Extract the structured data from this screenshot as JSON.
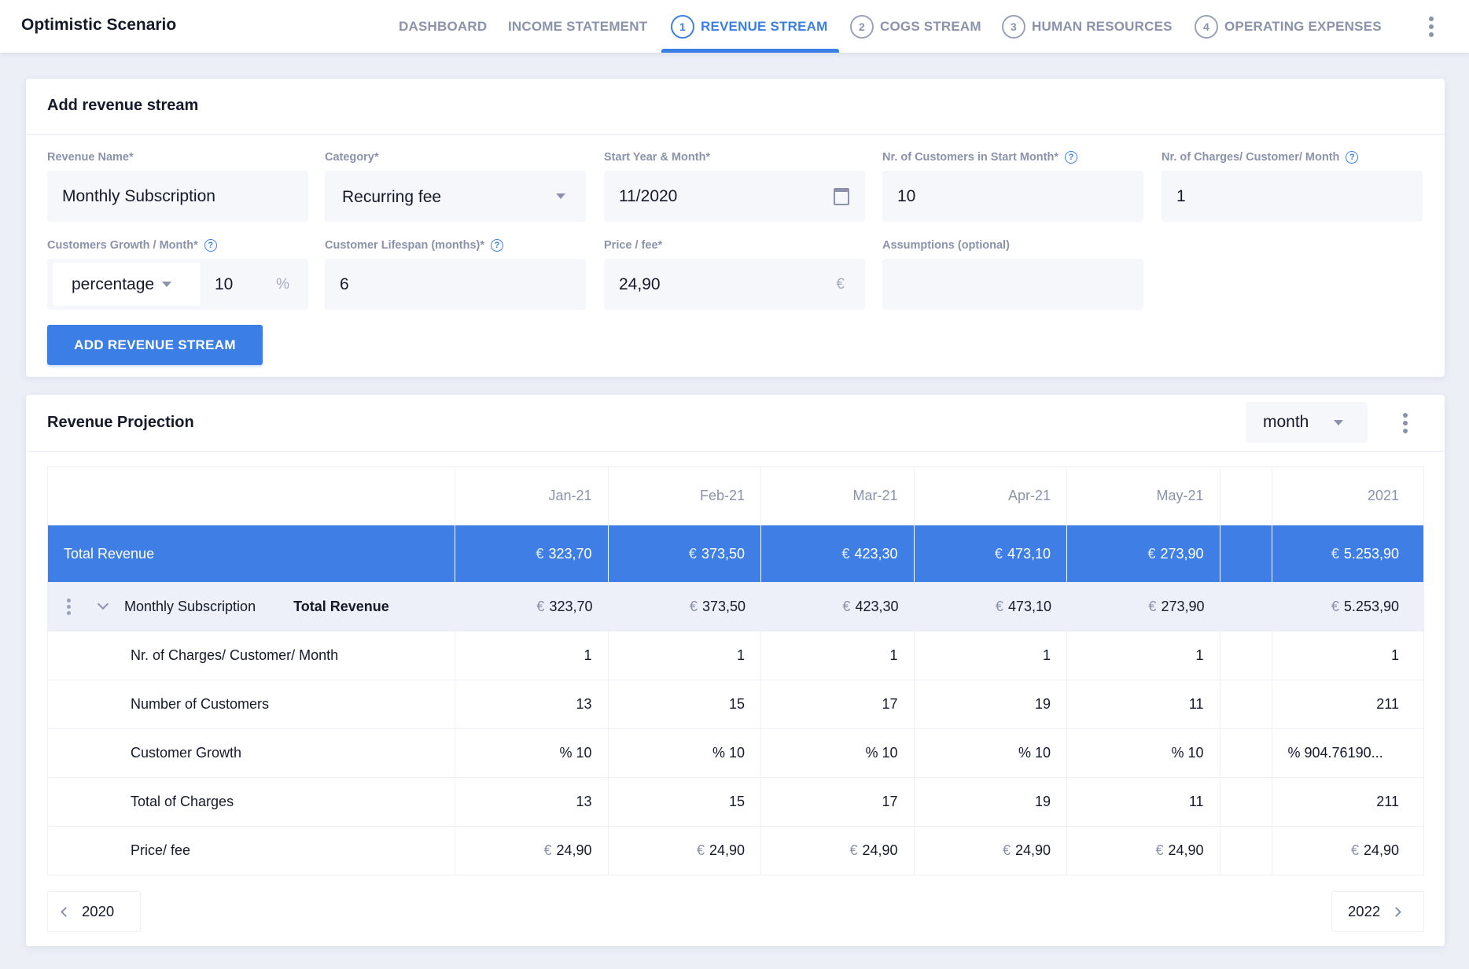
{
  "app": {
    "title": "Optimistic Scenario"
  },
  "nav": {
    "items": [
      {
        "label": "DASHBOARD",
        "step": ""
      },
      {
        "label": "INCOME STATEMENT",
        "step": ""
      },
      {
        "label": "REVENUE STREAM",
        "step": "1",
        "active": true
      },
      {
        "label": "COGS STREAM",
        "step": "2"
      },
      {
        "label": "HUMAN RESOURCES",
        "step": "3"
      },
      {
        "label": "OPERATING EXPENSES",
        "step": "4"
      }
    ]
  },
  "add_form": {
    "title": "Add revenue stream",
    "fields": {
      "revenue_name": {
        "label": "Revenue Name*",
        "value": "Monthly Subscription"
      },
      "category": {
        "label": "Category*",
        "value": "Recurring fee"
      },
      "start": {
        "label": "Start Year & Month*",
        "value": "11/2020"
      },
      "customers_start": {
        "label": "Nr. of Customers in Start Month*",
        "value": "10"
      },
      "charges": {
        "label": "Nr. of Charges/ Customer/ Month",
        "value": "1"
      },
      "growth": {
        "label": "Customers Growth / Month*",
        "type": "percentage",
        "value": "10",
        "unit": "%"
      },
      "lifespan": {
        "label": "Customer Lifespan (months)*",
        "value": "6"
      },
      "price": {
        "label": "Price / fee*",
        "value": "24,90",
        "unit": "€"
      },
      "assumptions": {
        "label": "Assumptions (optional)",
        "value": ""
      }
    },
    "submit_label": "ADD REVENUE STREAM"
  },
  "projection": {
    "title": "Revenue Projection",
    "period": "month",
    "columns": [
      "Jan-21",
      "Feb-21",
      "Mar-21",
      "Apr-21",
      "May-21",
      "",
      "2021"
    ],
    "total_row": {
      "label": "Total Revenue",
      "values": [
        "323,70",
        "373,50",
        "423,30",
        "473,10",
        "273,90",
        "",
        "5.253,90"
      ]
    },
    "stream": {
      "name": "Monthly Subscription",
      "total_label": "Total Revenue",
      "values": [
        "323,70",
        "373,50",
        "423,30",
        "473,10",
        "273,90",
        "",
        "5.253,90"
      ]
    },
    "rows": [
      {
        "label": "Nr. of Charges/ Customer/ Month",
        "values": [
          "1",
          "1",
          "1",
          "1",
          "1",
          "",
          "1"
        ]
      },
      {
        "label": "Number of Customers",
        "values": [
          "13",
          "15",
          "17",
          "19",
          "11",
          "",
          "211"
        ]
      },
      {
        "label": "Customer Growth",
        "values": [
          "% 10",
          "% 10",
          "% 10",
          "% 10",
          "% 10",
          "",
          "% 904.76190..."
        ]
      },
      {
        "label": "Total of Charges",
        "values": [
          "13",
          "15",
          "17",
          "19",
          "11",
          "",
          "211"
        ]
      },
      {
        "label": "Price/ fee",
        "values": [
          "€ 24,90",
          "€ 24,90",
          "€ 24,90",
          "€ 24,90",
          "€ 24,90",
          "",
          "€ 24,90"
        ]
      }
    ],
    "currency": "€",
    "prev_year": "2020",
    "next_year": "2022"
  },
  "colors": {
    "accent": "#3b7fe6",
    "muted": "#8a93ab",
    "background": "#eceff6"
  }
}
